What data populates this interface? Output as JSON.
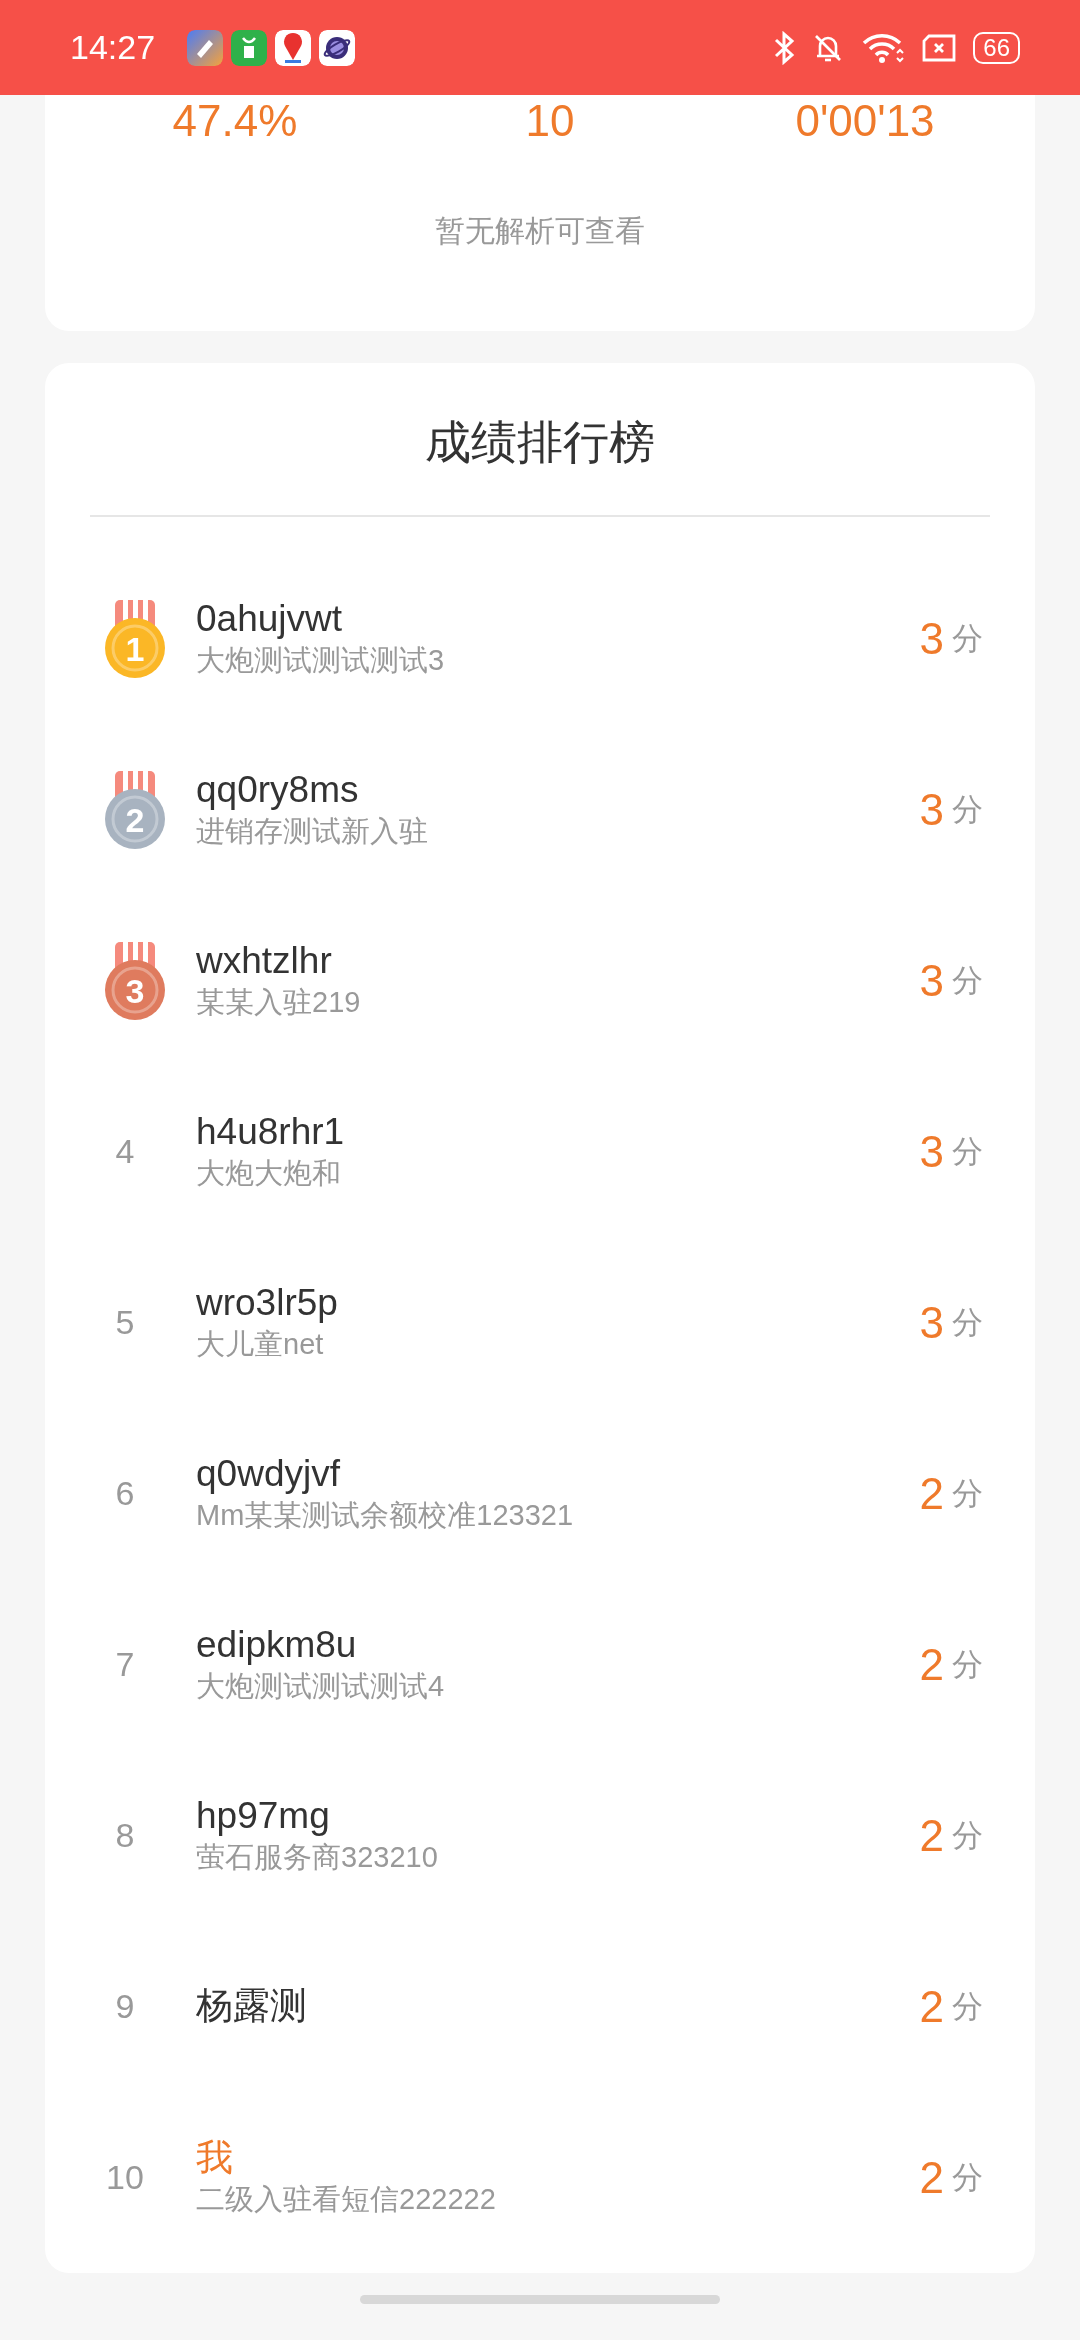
{
  "status_bar": {
    "time": "14:27",
    "battery": "66"
  },
  "summary": {
    "stats": [
      "47.4%",
      "10",
      "0'00'13"
    ],
    "note": "暂无解析可查看"
  },
  "ranking": {
    "title": "成绩排行榜",
    "rows": [
      {
        "kind": "medal",
        "rank": "1",
        "color": "#fbb726",
        "name": "0ahujvwt",
        "subtitle": "大炮测试测试测试3",
        "score": "3",
        "unit": "分",
        "is_me": false
      },
      {
        "kind": "medal",
        "rank": "2",
        "color": "#a8b3c0",
        "name": "qq0ry8ms",
        "subtitle": "进销存测试新入驻",
        "score": "3",
        "unit": "分",
        "is_me": false
      },
      {
        "kind": "medal",
        "rank": "3",
        "color": "#df7b5e",
        "name": "wxhtzlhr",
        "subtitle": "某某入驻219",
        "score": "3",
        "unit": "分",
        "is_me": false
      },
      {
        "kind": "number",
        "rank": "4",
        "name": "h4u8rhr1",
        "subtitle": "大炮大炮和",
        "score": "3",
        "unit": "分",
        "is_me": false
      },
      {
        "kind": "number",
        "rank": "5",
        "name": "wro3lr5p",
        "subtitle": "大儿童net",
        "score": "3",
        "unit": "分",
        "is_me": false
      },
      {
        "kind": "number",
        "rank": "6",
        "name": "q0wdyjvf",
        "subtitle": "Mm某某测试余额校准123321",
        "score": "2",
        "unit": "分",
        "is_me": false
      },
      {
        "kind": "number",
        "rank": "7",
        "name": "edipkm8u",
        "subtitle": "大炮测试测试测试4",
        "score": "2",
        "unit": "分",
        "is_me": false
      },
      {
        "kind": "number",
        "rank": "8",
        "name": "hp97mg",
        "subtitle": "萤石服务商323210",
        "score": "2",
        "unit": "分",
        "is_me": false
      },
      {
        "kind": "number",
        "rank": "9",
        "name": "杨露测",
        "score": "2",
        "unit": "分",
        "is_me": false
      },
      {
        "kind": "number",
        "rank": "10",
        "name": "我",
        "subtitle": "二级入驻看短信222222",
        "score": "2",
        "unit": "分",
        "is_me": true
      }
    ]
  }
}
